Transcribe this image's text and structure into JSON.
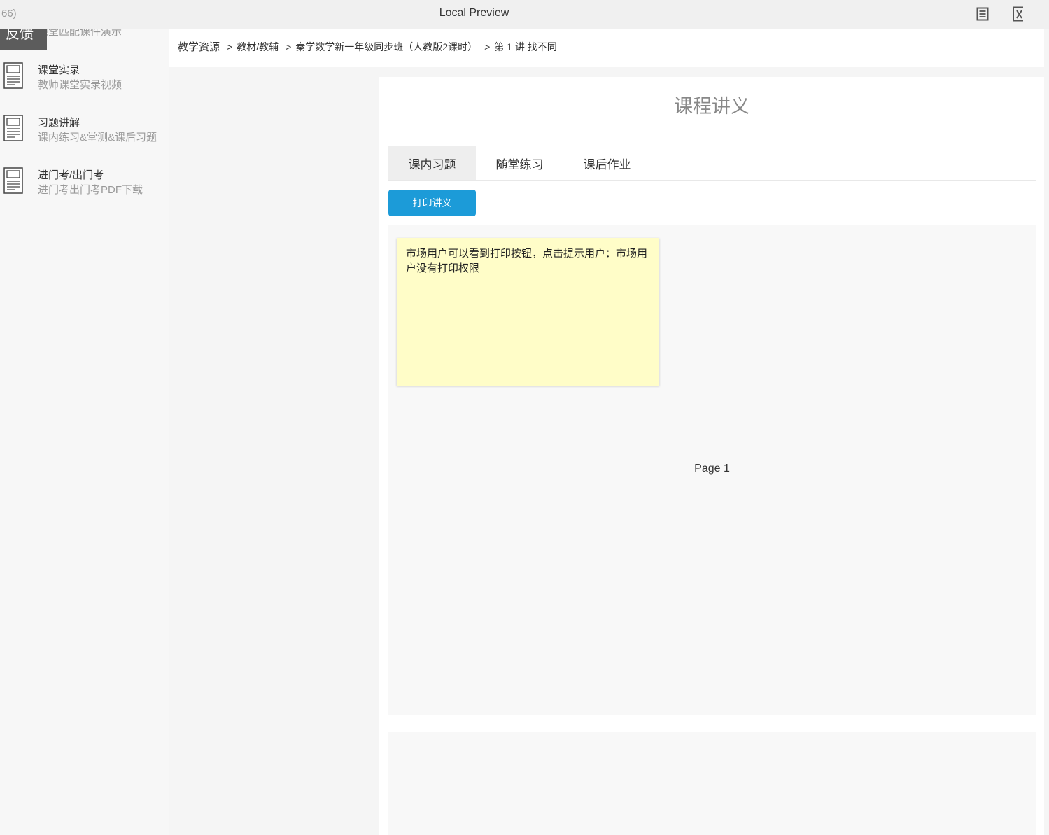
{
  "titlebar": {
    "left_text": "66)",
    "title": "Local Preview",
    "icons": [
      "notes-icon",
      "variables-icon"
    ]
  },
  "sidebar": {
    "feedback_label": "反馈",
    "cut_item_desc": "课堂匹配课件演示",
    "items": [
      {
        "title": "课堂实录",
        "desc": "教师课堂实录视频",
        "icon": "document-icon"
      },
      {
        "title": "习题讲解",
        "desc": "课内练习&堂测&课后习题",
        "icon": "document-icon"
      },
      {
        "title": "进门考/出门考",
        "desc": "进门考出门考PDF下载",
        "icon": "document-icon"
      }
    ]
  },
  "breadcrumb": {
    "items": [
      "教学资源",
      "教材/教辅",
      "秦学数学新一年级同步班（人教版2课时）",
      "第 1 讲  找不同"
    ],
    "separator": ">"
  },
  "main": {
    "title": "课程讲义",
    "tabs": [
      {
        "label": "课内习题",
        "active": true
      },
      {
        "label": "随堂练习",
        "active": false
      },
      {
        "label": "课后作业",
        "active": false
      }
    ],
    "print_button_label": "打印讲义",
    "print_button_color": "#1c9bd8",
    "sticky_note": {
      "text": "市场用户可以看到打印按钮，点击提示用户：市场用户没有打印权限",
      "color": "#fffdc8"
    },
    "page_label": "Page 1"
  }
}
